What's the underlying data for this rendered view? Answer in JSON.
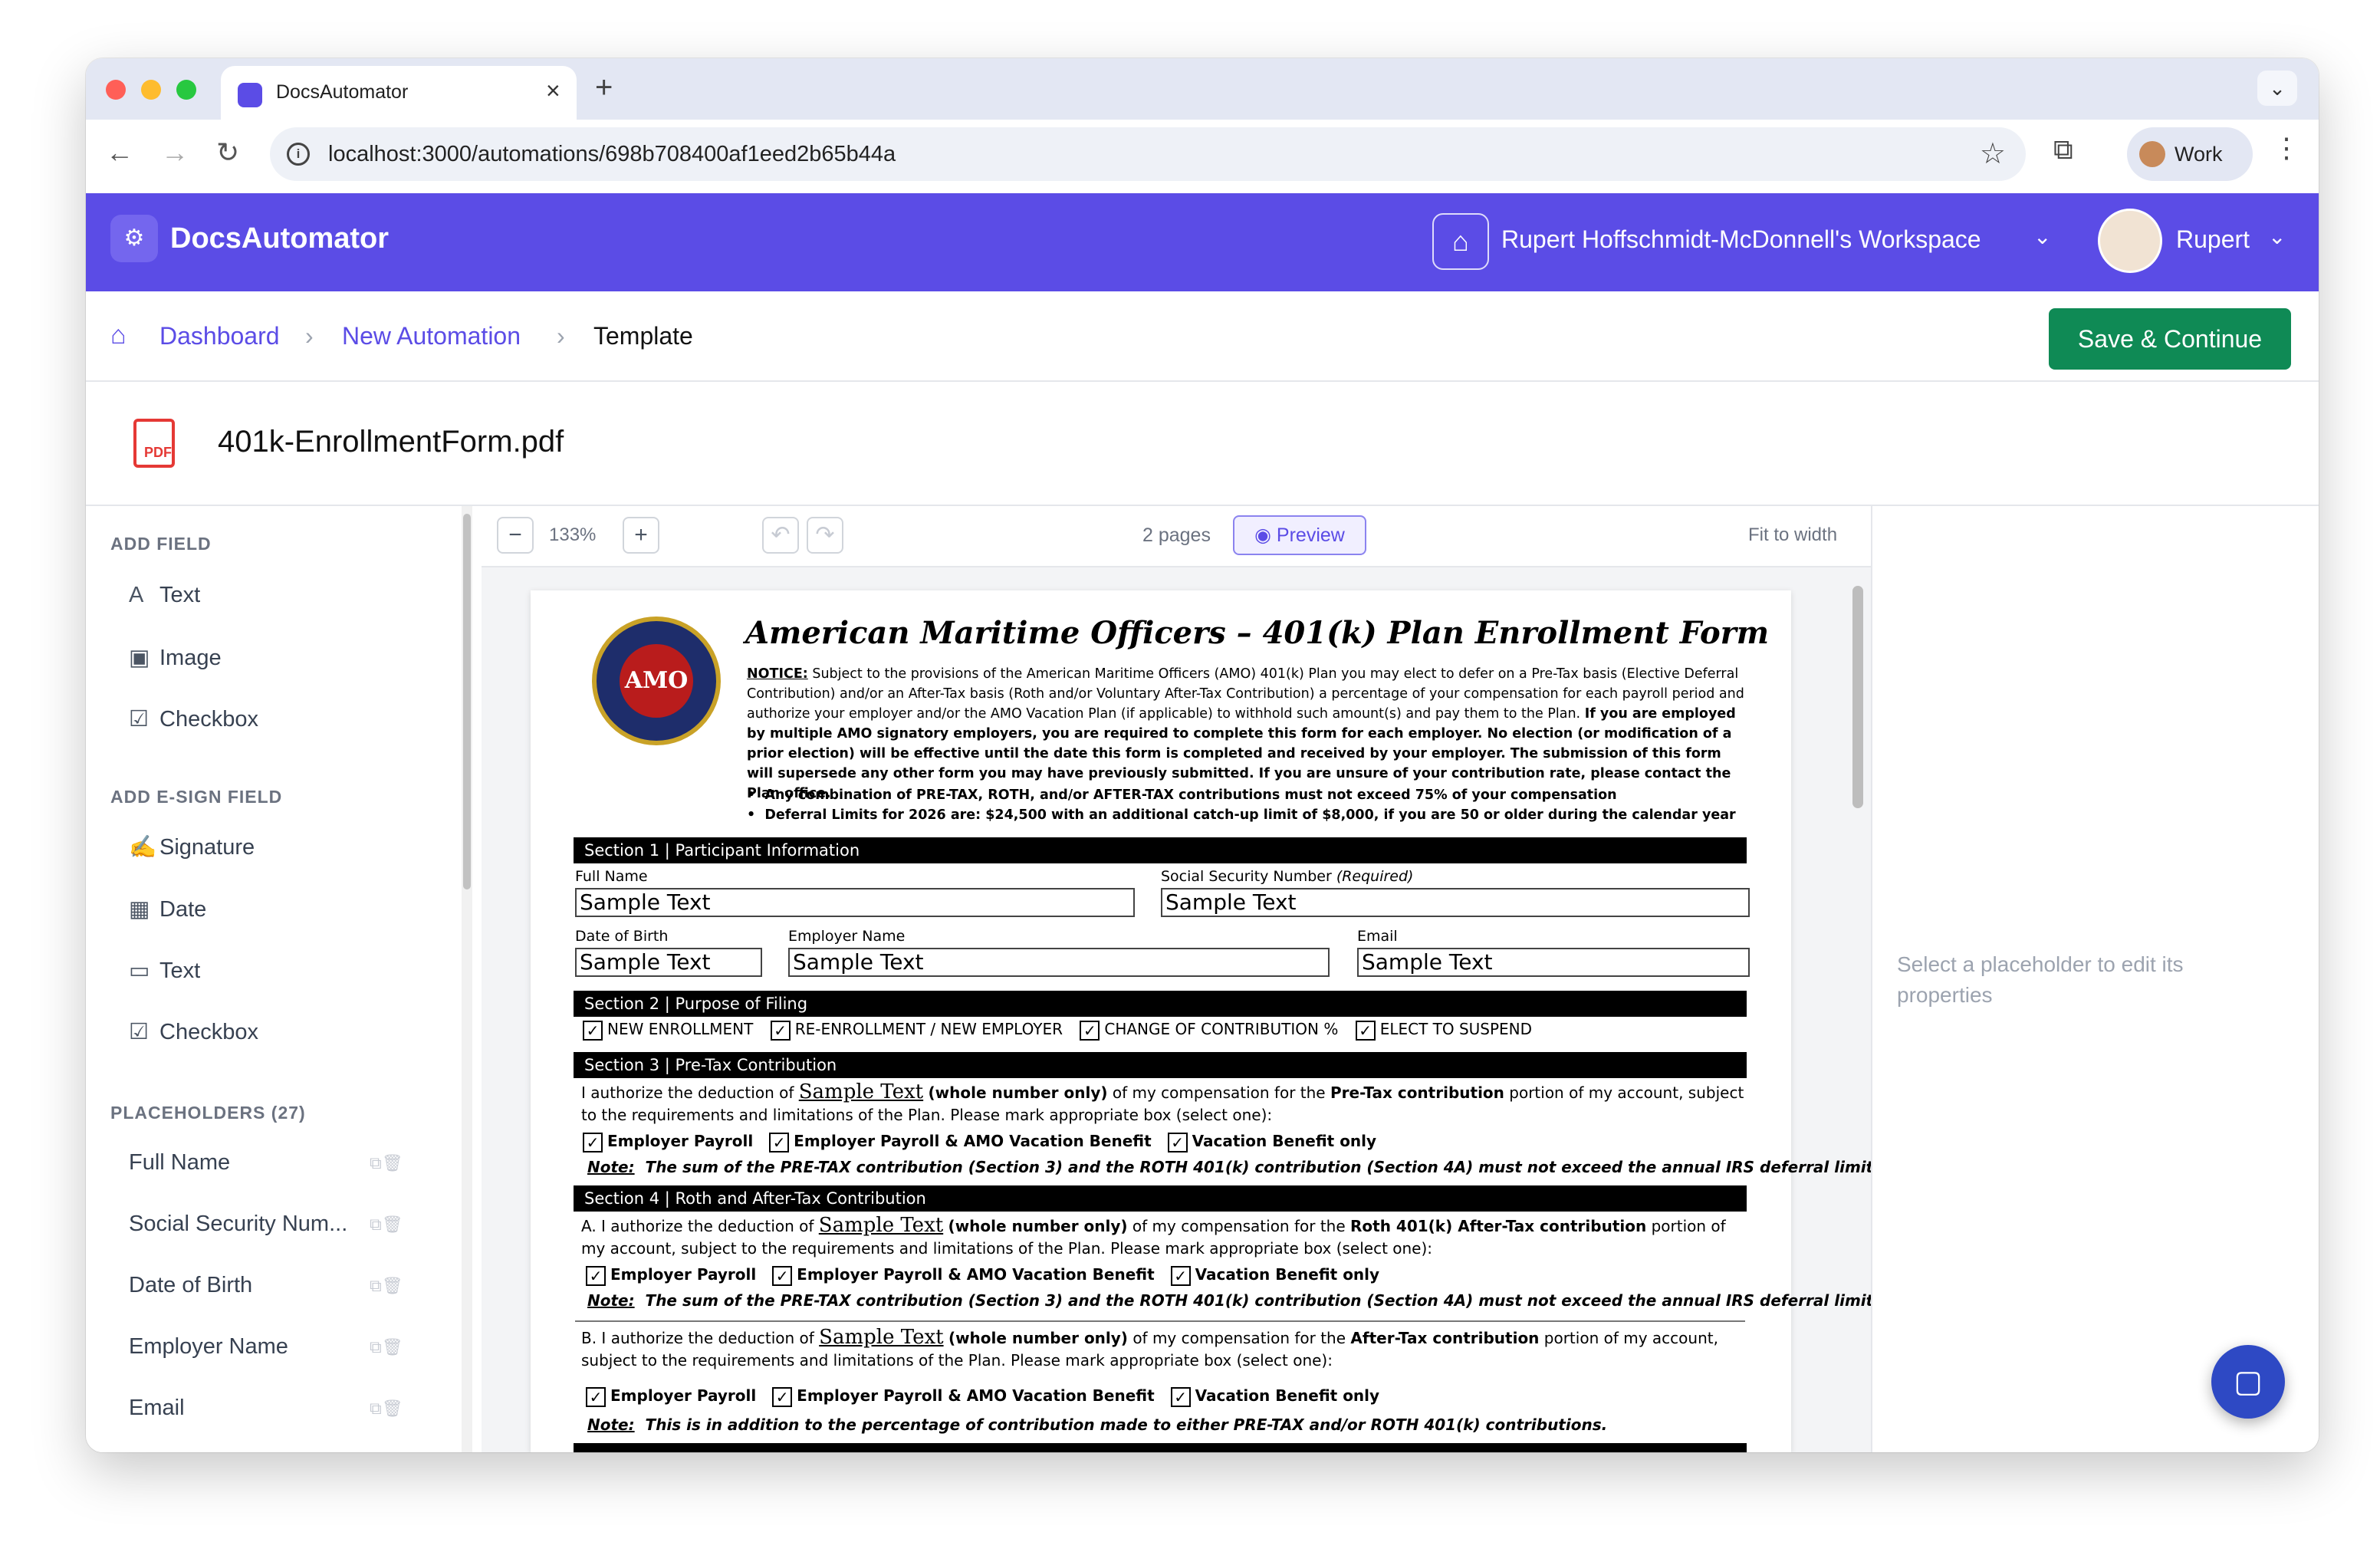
{
  "browser": {
    "tab_title": "DocsAutomator",
    "url": "localhost:3000/automations/698b708400af1eed2b65b44a",
    "profile_label": "Work"
  },
  "app": {
    "brand": "DocsAutomator",
    "workspace": "Rupert Hoffschmidt-McDonnell's Workspace",
    "user": "Rupert"
  },
  "breadcrumb": {
    "dashboard": "Dashboard",
    "new_automation": "New Automation",
    "current": "Template",
    "save_label": "Save & Continue"
  },
  "file": {
    "name": "401k-EnrollmentForm.pdf",
    "icon_label": "PDF"
  },
  "sidebar": {
    "add_field_heading": "ADD FIELD",
    "add_field_items": [
      {
        "label": "Text",
        "icon": "text-icon"
      },
      {
        "label": "Image",
        "icon": "image-icon"
      },
      {
        "label": "Checkbox",
        "icon": "checkbox-icon"
      }
    ],
    "esign_heading": "ADD E-SIGN FIELD",
    "esign_items": [
      {
        "label": "Signature",
        "icon": "signature-icon"
      },
      {
        "label": "Date",
        "icon": "calendar-icon"
      },
      {
        "label": "Text",
        "icon": "text-field-icon"
      },
      {
        "label": "Checkbox",
        "icon": "checkbox-icon"
      }
    ],
    "placeholders_heading": "PLACEHOLDERS (27)",
    "placeholders": [
      "Full Name",
      "Social Security Num...",
      "Date of Birth",
      "Employer Name",
      "Email"
    ]
  },
  "viewer": {
    "zoom": "133%",
    "pages": "2 pages",
    "preview_label": "Preview",
    "fit_label": "Fit to width"
  },
  "pdf": {
    "title": "American Maritime Officers – 401(k) Plan Enrollment Form",
    "seal_text": "AMO",
    "notice_label": "NOTICE:",
    "notice_text": "Subject to the provisions of the American Maritime Officers (AMO) 401(k) Plan you may elect to defer on a Pre-Tax basis (Elective Deferral Contribution) and/or an After-Tax basis (Roth and/or Voluntary After-Tax Contribution) a percentage of your compensation for each payroll period and authorize your employer and/or the AMO Vacation Plan (if applicable) to withhold such amount(s) and pay them to the Plan.",
    "notice_bold": "If you are employed by multiple AMO signatory employers, you are required to complete this form for each employer. No election (or modification of a prior election) will be effective until the date this form is completed and received by your employer. The submission of this form will supersede any other form you may have previously submitted. If you are unsure of your contribution rate, please contact the Plan office.",
    "bullet1": "Any combination of PRE-TAX, ROTH, and/or AFTER-TAX contributions must not exceed 75% of your compensation",
    "bullet2": "Deferral Limits for 2026 are: $24,500 with an additional catch-up limit of $8,000, if you are 50 or older during the calendar year",
    "section1": "Section 1 | Participant Information",
    "lbl_full_name": "Full Name",
    "lbl_ssn": "Social Security Number",
    "lbl_ssn_req": "(Required)",
    "lbl_dob": "Date of Birth",
    "lbl_employer": "Employer Name",
    "lbl_email": "Email",
    "sample": "Sample Text",
    "section2": "Section 2 | Purpose of Filing",
    "purpose": [
      "NEW ENROLLMENT",
      "RE-ENROLLMENT / NEW EMPLOYER",
      "CHANGE OF CONTRIBUTION %",
      "ELECT TO SUSPEND"
    ],
    "section3": "Section 3 | Pre-Tax Contribution",
    "s3_pre": "I authorize the deduction of",
    "sample_short": "Sample Text",
    "s3_mid": "(whole number only)",
    "s3_post": "of my compensation for the",
    "s3_bold": "Pre-Tax contribution",
    "s3_end": "portion of my account, subject to the requirements and limitations of the Plan.  Please mark appropriate box (select one):",
    "opt1": "Employer Payroll",
    "opt2": "Employer Payroll & AMO Vacation Benefit",
    "opt3": "Vacation Benefit only",
    "note_label": "Note:",
    "note_text": "The sum of the PRE-TAX contribution (Section 3) and the ROTH 401(k) contribution (Section 4A) must not exceed the annual IRS deferral limit.",
    "section4": "Section 4 | Roth and After-Tax Contribution",
    "s4a_pre": "A. I authorize the deduction of",
    "s4a_bold": "Roth 401(k) After-Tax contribution",
    "s4a_end": "portion of my account, subject to the requirements and limitations of the Plan.  Please mark appropriate box (select one):",
    "s4b_pre": "B. I authorize the deduction of",
    "s4b_bold": "After-Tax contribution",
    "s4b_end": "portion of my account, subject to the requirements and limitations of the Plan.  Please mark appropriate box (select one):",
    "note2_text": "This is in addition to the percentage of contribution made to either PRE-TAX and/or ROTH 401(k) contributions."
  },
  "right_panel": {
    "hint": "Select a placeholder to edit its properties"
  },
  "colors": {
    "brand": "#5b4ce6",
    "save": "#0f8a55"
  }
}
